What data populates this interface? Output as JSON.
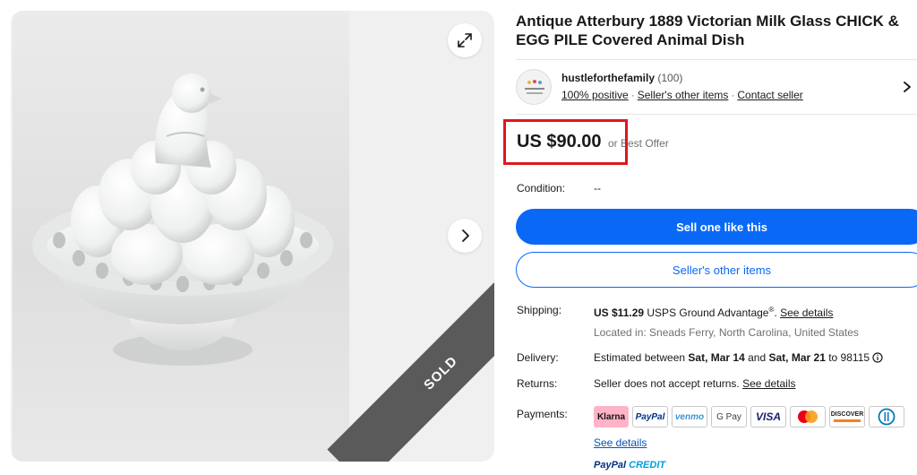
{
  "gallery": {
    "sold_label": "SOLD"
  },
  "listing": {
    "title": "Antique Atterbury 1889 Victorian Milk Glass CHICK & EGG PILE Covered Animal Dish"
  },
  "seller": {
    "name": "hustleforthefamily",
    "feedback_count": "(100)",
    "positive": "100% positive",
    "other_items": "Seller's other items",
    "contact": "Contact seller"
  },
  "price": {
    "amount": "US $90.00",
    "best_offer": "or Best Offer"
  },
  "condition": {
    "label": "Condition:",
    "value": "--"
  },
  "buttons": {
    "sell_one": "Sell one like this",
    "other_items": "Seller's other items"
  },
  "shipping": {
    "label": "Shipping:",
    "cost": "US $11.29",
    "service": "USPS Ground Advantage",
    "reg": "®",
    "see_details": "See details",
    "location": "Located in: Sneads Ferry, North Carolina, United States"
  },
  "delivery": {
    "label": "Delivery:",
    "prefix": "Estimated between",
    "start": "Sat, Mar 14",
    "and": "and",
    "end": "Sat, Mar 21",
    "suffix": "to 98115"
  },
  "returns": {
    "label": "Returns:",
    "text": "Seller does not accept returns.",
    "see_details": "See details"
  },
  "payments": {
    "label": "Payments:",
    "methods": [
      "Klarna",
      "PayPal",
      "venmo",
      "G Pay",
      "VISA",
      "Mastercard",
      "DISCOVER",
      "Diners Club"
    ],
    "see_details": "See details",
    "paypal_credit_1": "PayPal",
    "paypal_credit_2": "CREDIT"
  },
  "colors": {
    "accent": "#0968f6",
    "highlight": "#e0161d",
    "sold_banner": "#5a5a5a"
  },
  "icons": [
    "expand-icon",
    "chevron-right-icon",
    "info-icon"
  ]
}
